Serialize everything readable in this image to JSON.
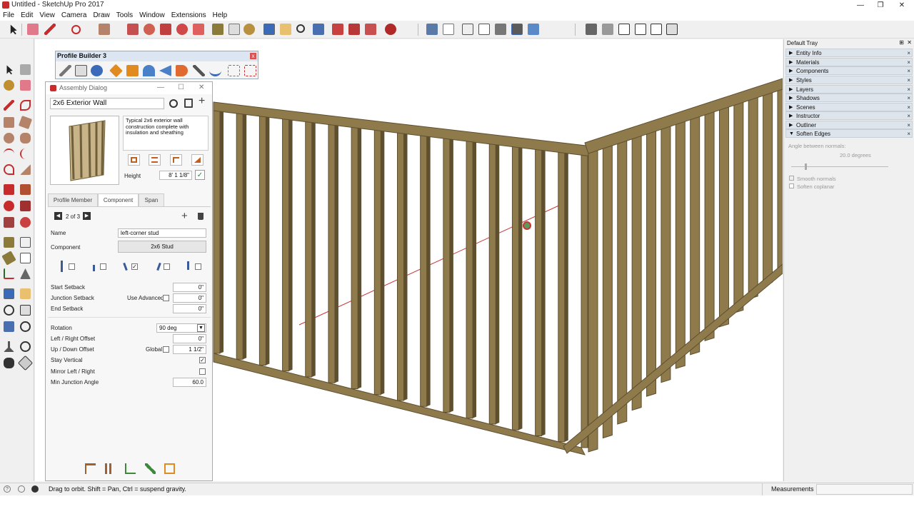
{
  "window": {
    "title": "Untitled - SketchUp Pro 2017",
    "min": "—",
    "restore": "❐",
    "close": "✕"
  },
  "menu": [
    "File",
    "Edit",
    "View",
    "Camera",
    "Draw",
    "Tools",
    "Window",
    "Extensions",
    "Help"
  ],
  "profile_builder": {
    "title": "Profile Builder 3",
    "close": "x"
  },
  "assembly": {
    "title": "Assembly Dialog",
    "name": "2x6 Exterior Wall",
    "description": "Typical 2x6 exterior wall construction complete with insulation and sheathing",
    "height_label": "Height",
    "height_value": "8' 1 1/8\"",
    "tabs": [
      "Profile Member",
      "Component",
      "Span"
    ],
    "pager": "2 of 3",
    "name_label": "Name",
    "name_value": "left-corner stud",
    "component_label": "Component",
    "component_value": "2x6 Stud",
    "start_setback_label": "Start Setback",
    "start_setback_value": "0\"",
    "junction_setback_label": "Junction Setback",
    "use_advanced_label": "Use Advanced",
    "junction_setback_value": "0\"",
    "end_setback_label": "End Setback",
    "end_setback_value": "0\"",
    "rotation_label": "Rotation",
    "rotation_value": "90 deg",
    "lr_offset_label": "Left / Right Offset",
    "lr_offset_value": "0\"",
    "ud_offset_label": "Up / Down Offset",
    "global_label": "Global",
    "ud_offset_value": "1 1/2\"",
    "stay_vertical_label": "Stay Vertical",
    "stay_vertical": true,
    "mirror_label": "Mirror Left / Right",
    "mirror": false,
    "min_junction_label": "Min Junction Angle",
    "min_junction_value": "60.0",
    "placement_checks": [
      false,
      false,
      true,
      false,
      false
    ]
  },
  "tray": {
    "title": "Default Tray",
    "sections": [
      "Entity Info",
      "Materials",
      "Components",
      "Styles",
      "Layers",
      "Shadows",
      "Scenes",
      "Instructor",
      "Outliner",
      "Soften Edges"
    ],
    "soften": {
      "angle_label": "Angle between normals:",
      "angle_value": "20.0  degrees",
      "smooth_normals": "Smooth normals",
      "soften_coplanar": "Soften coplanar"
    }
  },
  "status": {
    "message": "Drag to orbit. Shift = Pan, Ctrl = suspend gravity.",
    "measurements_label": "Measurements",
    "measurements_value": ""
  },
  "colors": {
    "stud": "#8f7a4c",
    "stud_dark": "#5e4f2f",
    "axis_red": "#cc3333",
    "accent_red": "#c82b2b"
  }
}
